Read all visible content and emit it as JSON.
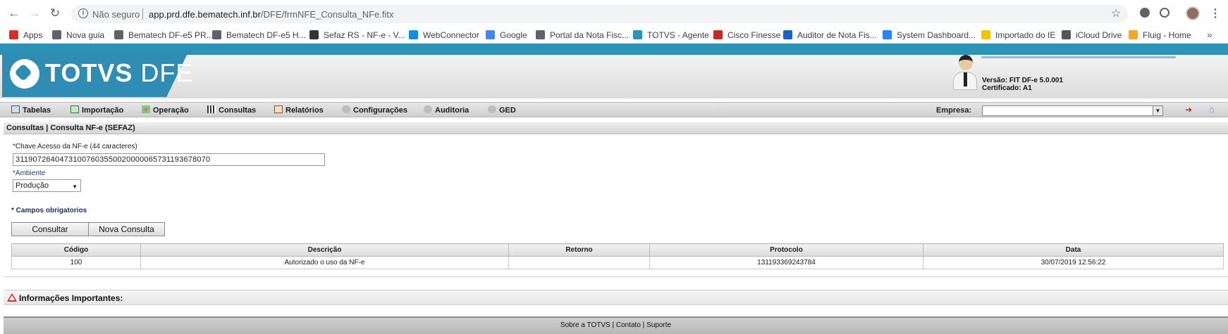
{
  "browser": {
    "not_secure": "Não seguro",
    "url_host": "app.prd.dfe.bematech.inf.br",
    "url_path": "/DFE/frmNFE_Consulta_NFe.fitx",
    "bookmarks": [
      {
        "label": "Apps",
        "icon": "apps-grid-icon",
        "color": "#d93025"
      },
      {
        "label": "Nova guia",
        "icon": "globe-icon",
        "color": "#5f6368"
      },
      {
        "label": "Bematech DF-e5 PR...",
        "icon": "globe-icon",
        "color": "#5f6368"
      },
      {
        "label": "Bematech DF-e5 H...",
        "icon": "globe-icon",
        "color": "#5f6368"
      },
      {
        "label": "Sefaz RS - NF-e - V...",
        "icon": "sefaz-icon",
        "color": "#333333"
      },
      {
        "label": "WebConnector",
        "icon": "teamviewer-icon",
        "color": "#0e8ee9"
      },
      {
        "label": "Google",
        "icon": "google-icon",
        "color": "#4285f4"
      },
      {
        "label": "Portal da Nota Fisc...",
        "icon": "globe-icon",
        "color": "#5f6368"
      },
      {
        "label": "TOTVS - Agente",
        "icon": "totvs-icon",
        "color": "#2b93b8"
      },
      {
        "label": "Cisco Finesse",
        "icon": "cisco-icon",
        "color": "#c62828"
      },
      {
        "label": "Auditor de Nota Fis...",
        "icon": "auditor-icon",
        "color": "#1565c0"
      },
      {
        "label": "System Dashboard...",
        "icon": "jira-icon",
        "color": "#2684ff"
      },
      {
        "label": "Importado do IE",
        "icon": "folder-icon",
        "color": "#f4c20d"
      },
      {
        "label": "iCloud Drive",
        "icon": "apple-icon",
        "color": "#555555"
      },
      {
        "label": "Fluig - Home",
        "icon": "fluig-icon",
        "color": "#f5a623"
      }
    ]
  },
  "header": {
    "logo_bold": "TOTVS",
    "logo_thin": "DFE",
    "versao": "Versão: FIT DF-e 5.0.001",
    "certificado": "Certificado: A1"
  },
  "menu": {
    "items": [
      {
        "label": "Tabelas",
        "icon": "table-icon"
      },
      {
        "label": "Importação",
        "icon": "import-icon"
      },
      {
        "label": "Operação",
        "icon": "operation-icon"
      },
      {
        "label": "Consultas",
        "icon": "grid-icon"
      },
      {
        "label": "Relatórios",
        "icon": "report-icon"
      },
      {
        "label": "Configurações",
        "icon": "gear-icon"
      },
      {
        "label": "Auditoria",
        "icon": "audit-icon"
      },
      {
        "label": "GED",
        "icon": "ged-icon"
      }
    ],
    "empresa_label": "Empresa:",
    "empresa_value": ""
  },
  "breadcrumb": "Consultas | Consulta NF-e (SEFAZ)",
  "form": {
    "chave_label_req": "*",
    "chave_label": "Chave Acesso da NF-e (44 caracteres)",
    "chave_value": "31190726404731007603550020000065731193678070",
    "ambiente_label_req": "*",
    "ambiente_label": "Ambiente",
    "ambiente_value": "Produção",
    "campos_obrigatorios": "* Campos obrigatorios",
    "btn_consultar": "Consultar",
    "btn_nova_consulta": "Nova Consulta"
  },
  "table": {
    "columns": [
      "Código",
      "Descrição",
      "Retorno",
      "Protocolo",
      "Data"
    ],
    "rows": [
      [
        "100",
        "Autorizado o uso da NF-e",
        "",
        "131193369243784",
        "30/07/2019 12:56:22"
      ]
    ]
  },
  "info": {
    "title": "Informações Importantes:"
  },
  "footer": {
    "sobre": "Sobre a TOTVS",
    "contato": "Contato",
    "suporte": "Suporte",
    "sep": "|"
  },
  "colors": {
    "brand": "#2f8db3",
    "required_text": "#1e2f6b"
  }
}
